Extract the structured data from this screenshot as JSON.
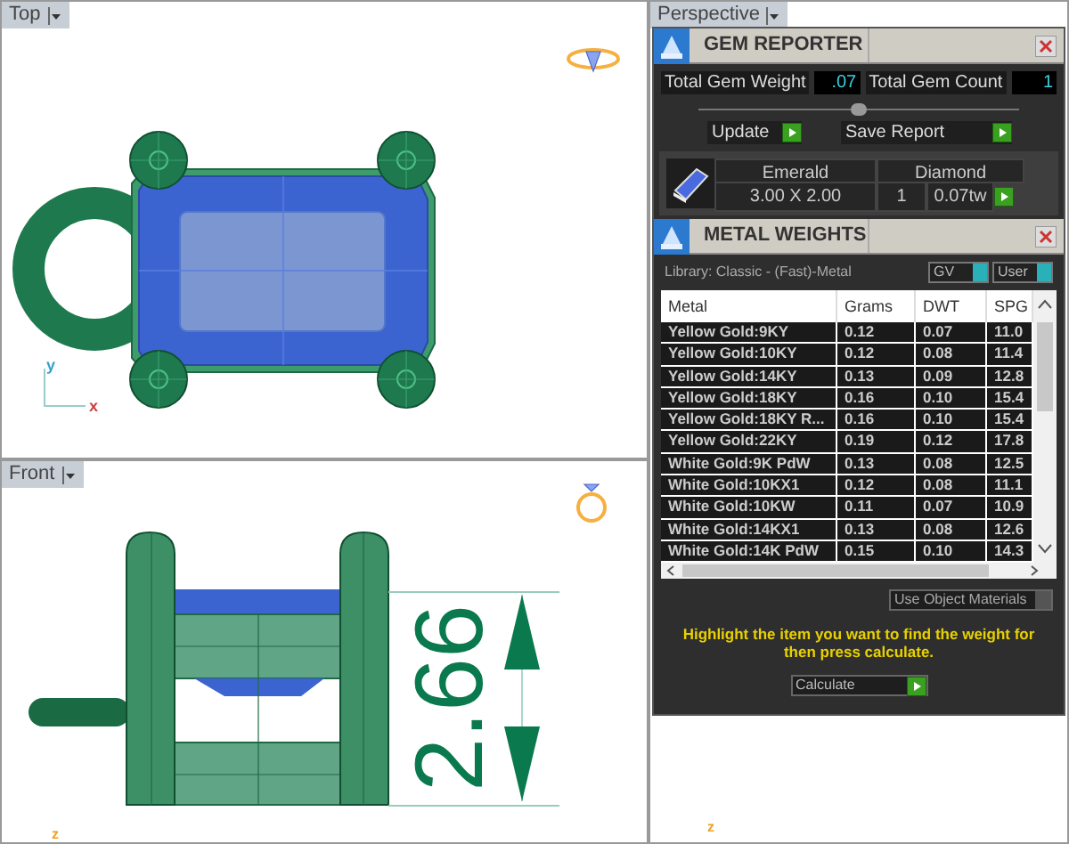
{
  "viewports": [
    {
      "kind": "top",
      "label": "Top",
      "axes": [
        "y",
        "x"
      ]
    },
    {
      "kind": "front",
      "label": "Front",
      "axes": [
        "z"
      ],
      "dimension": "2.66"
    },
    {
      "kind": "perspective",
      "label": "Perspective",
      "axes": [
        "z"
      ]
    }
  ],
  "gem_reporter": {
    "title": "GEM REPORTER",
    "weight_label": "Total Gem Weight",
    "weight_value": ".07",
    "count_label": "Total Gem Count",
    "count_value": "1",
    "slider": {
      "level": 0.5
    },
    "buttons": [
      "Update",
      "Save Report"
    ],
    "gem": {
      "shape": "Emerald",
      "type": "Diamond",
      "size": "3.00 X 2.00",
      "count": "1",
      "weight": "0.07tw"
    }
  },
  "metal_weights": {
    "title": "METAL WEIGHTS",
    "library": "Library: Classic - (Fast)-Metal",
    "toggles": [
      {
        "label": "GV",
        "on": true
      },
      {
        "label": "User",
        "on": true
      }
    ],
    "columns": [
      "Metal",
      "Grams",
      "DWT",
      "SPG"
    ],
    "rows": [
      [
        "Yellow Gold:9KY",
        "0.12",
        "0.07",
        "11.0"
      ],
      [
        "Yellow Gold:10KY",
        "0.12",
        "0.08",
        "11.4"
      ],
      [
        "Yellow Gold:14KY",
        "0.13",
        "0.09",
        "12.8"
      ],
      [
        "Yellow Gold:18KY",
        "0.16",
        "0.10",
        "15.4"
      ],
      [
        "Yellow Gold:18KY R...",
        "0.16",
        "0.10",
        "15.4"
      ],
      [
        "Yellow Gold:22KY",
        "0.19",
        "0.12",
        "17.8"
      ],
      [
        "White Gold:9K PdW",
        "0.13",
        "0.08",
        "12.5"
      ],
      [
        "White Gold:10KX1",
        "0.12",
        "0.08",
        "11.1"
      ],
      [
        "White Gold:10KW",
        "0.11",
        "0.07",
        "10.9"
      ],
      [
        "White Gold:14KX1",
        "0.13",
        "0.08",
        "12.6"
      ],
      [
        "White Gold:14K PdW",
        "0.15",
        "0.10",
        "14.3"
      ]
    ],
    "use_object_materials": {
      "label": "Use Object Materials",
      "on": false
    },
    "hint": "Highlight the item you want to find the weight for then press calculate.",
    "calculate": "Calculate"
  }
}
